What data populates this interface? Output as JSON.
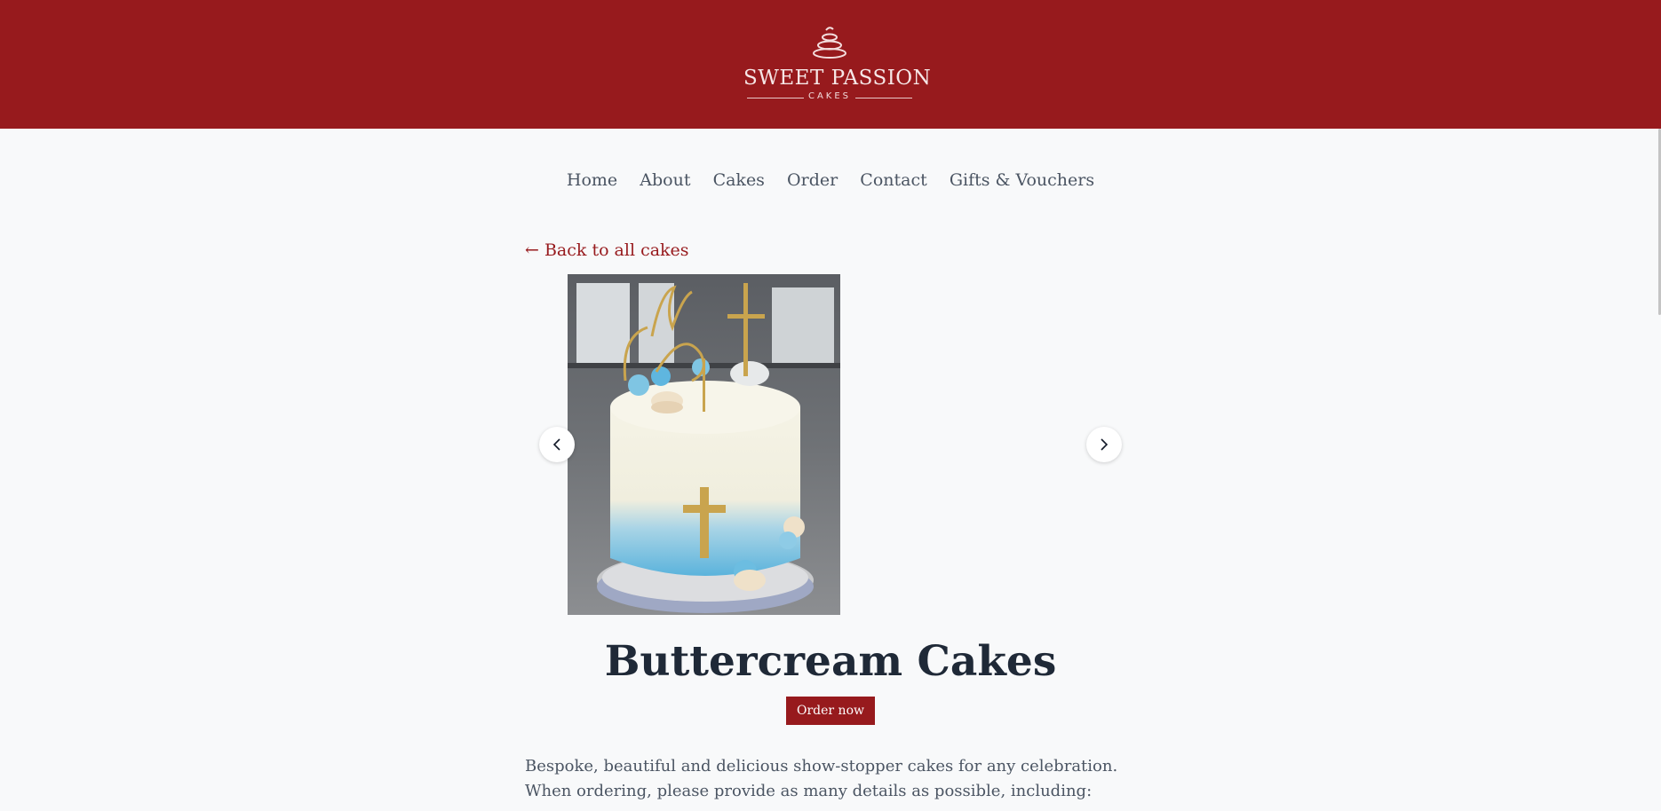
{
  "brand": {
    "name": "SWEET PASSION",
    "subtitle": "CAKES",
    "colors": {
      "header_bg": "#971a1d",
      "accent": "#971a1d",
      "text": "#1f2937"
    }
  },
  "nav": {
    "items": [
      {
        "label": "Home"
      },
      {
        "label": "About"
      },
      {
        "label": "Cakes"
      },
      {
        "label": "Order"
      },
      {
        "label": "Contact"
      },
      {
        "label": "Gifts & Vouchers"
      }
    ]
  },
  "back_link": {
    "label": "← Back to all cakes"
  },
  "carousel": {
    "prev_icon": "chevron-left-icon",
    "next_icon": "chevron-right-icon"
  },
  "product": {
    "title": "Buttercream Cakes",
    "order_button": "Order now",
    "description": [
      "Bespoke, beautiful and delicious show-stopper cakes for any celebration.",
      "When ordering, please provide as many details as possible, including:"
    ]
  }
}
